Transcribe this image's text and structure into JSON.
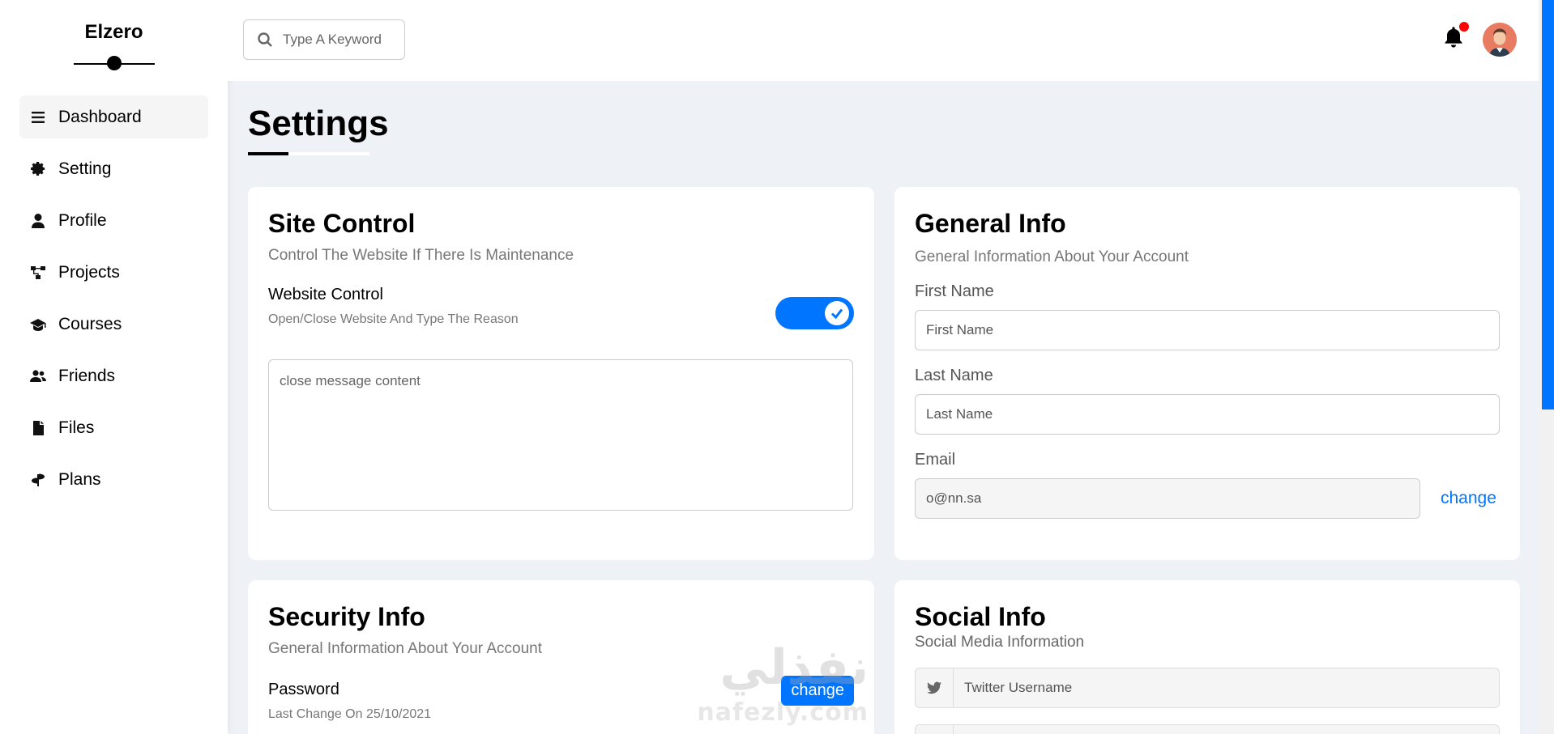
{
  "sidebar": {
    "brand": "Elzero",
    "items": [
      {
        "label": "Dashboard",
        "icon": "menu-icon",
        "active": true
      },
      {
        "label": "Setting",
        "icon": "gear-icon"
      },
      {
        "label": "Profile",
        "icon": "user-icon"
      },
      {
        "label": "Projects",
        "icon": "diagram-icon"
      },
      {
        "label": "Courses",
        "icon": "graduation-cap-icon"
      },
      {
        "label": "Friends",
        "icon": "users-icon"
      },
      {
        "label": "Files",
        "icon": "file-icon"
      },
      {
        "label": "Plans",
        "icon": "route-icon"
      }
    ]
  },
  "topbar": {
    "search_placeholder": "Type A Keyword",
    "notification_dot": true
  },
  "page": {
    "title": "Settings"
  },
  "site_control": {
    "title": "Site Control",
    "description": "Control The Website If There Is Maintenance",
    "website_control_label": "Website Control",
    "website_control_sub": "Open/Close Website And Type The Reason",
    "toggle_on": true,
    "message_placeholder": "close message content"
  },
  "general_info": {
    "title": "General Info",
    "description": "General Information About Your Account",
    "first_name_label": "First Name",
    "first_name_placeholder": "First Name",
    "last_name_label": "Last Name",
    "last_name_placeholder": "Last Name",
    "email_label": "Email",
    "email_value": "o@nn.sa",
    "email_change": "change"
  },
  "security_info": {
    "title": "Security Info",
    "description": "General Information About Your Account",
    "password_label": "Password",
    "password_sub": "Last Change On 25/10/2021",
    "password_change": "change"
  },
  "social_info": {
    "title": "Social Info",
    "description": "Social Media Information",
    "twitter_placeholder": "Twitter Username"
  },
  "watermark": {
    "arabic": "نفذلي",
    "latin": "nafezly.com"
  },
  "colors": {
    "accent": "#0075ff",
    "page_bg": "#eef1f5",
    "notification": "#ff0000"
  }
}
